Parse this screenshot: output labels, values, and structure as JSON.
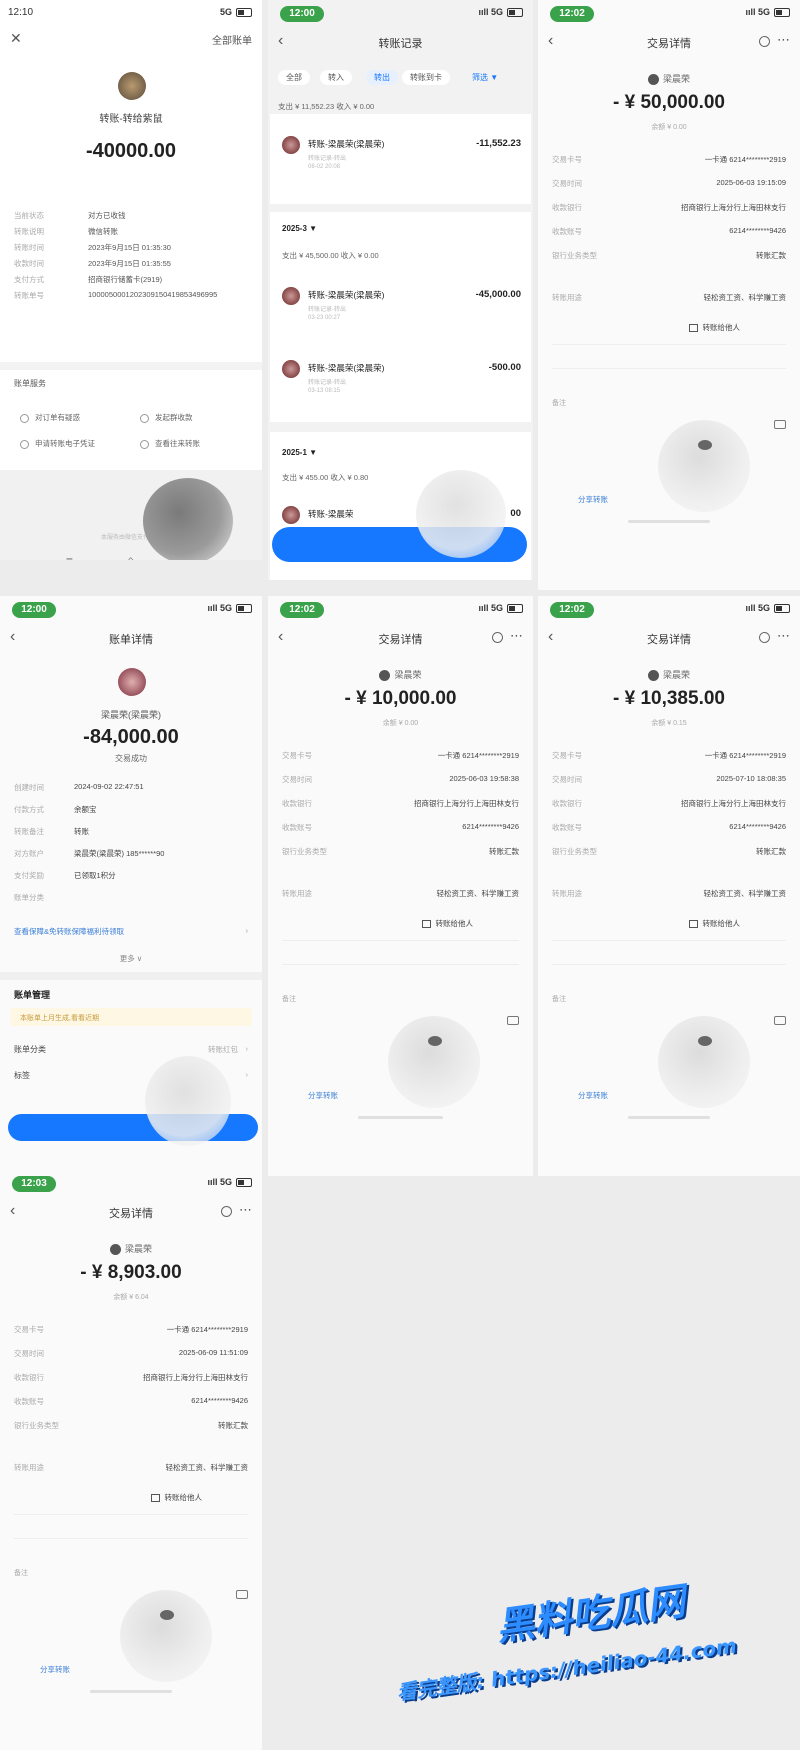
{
  "p1": {
    "status_time": "12:10",
    "close_label": "✕",
    "all_bills": "全部账单",
    "title": "转账-转给紫鼠",
    "amount": "-40000.00",
    "rows": [
      {
        "k": "当前状态",
        "v": "对方已收钱"
      },
      {
        "k": "转账说明",
        "v": "微信转账"
      },
      {
        "k": "转账时间",
        "v": "2023年9月15日 01:35:30"
      },
      {
        "k": "收款时间",
        "v": "2023年9月15日 01:35:55"
      },
      {
        "k": "支付方式",
        "v": "招商银行储蓄卡(2919)"
      },
      {
        "k": "转账单号",
        "v": "1000050001202309150419853496995"
      }
    ],
    "service_title": "账单服务",
    "services": [
      "对订单有疑惑",
      "发起群收款",
      "申请转账电子凭证",
      "查看往来转账"
    ],
    "bottom_hint": "本服务由微信支付提供"
  },
  "p2": {
    "status_time": "12:00",
    "signal": "5G",
    "title": "转账记录",
    "tabs": [
      "全部",
      "转入",
      "转出",
      "转账到卡",
      "筛选 ▼"
    ],
    "top_summary": "支出 ¥ 11,552.23    收入 ¥ 0.00",
    "items_top": [
      {
        "name": "转账-梁晨荣(梁晨荣)",
        "sub": "转账记录-转出",
        "time": "08-02 20:08",
        "amount": "-11,552.23"
      }
    ],
    "group2": {
      "month": "2025-3 ▼",
      "summary": "支出 ¥ 45,500.00    收入 ¥ 0.00",
      "items": [
        {
          "name": "转账-梁晨荣(梁晨荣)",
          "sub": "转账记录-转出",
          "time": "03-23 00:27",
          "amount": "-45,000.00"
        },
        {
          "name": "转账-梁晨荣(梁晨荣)",
          "sub": "转账记录-转出",
          "time": "03-13 08:15",
          "amount": "-500.00"
        }
      ]
    },
    "group3": {
      "month": "2025-1 ▼",
      "summary": "支出 ¥ 455.00    收入 ¥ 0.80",
      "items": [
        {
          "name": "转账-梁晨荣",
          "amount": "00"
        }
      ]
    }
  },
  "tx": {
    "nav_title": "交易详情",
    "payee": "梁晨荣",
    "labels": [
      "交易卡号",
      "交易时间",
      "收款银行",
      "收款账号",
      "银行业务类型",
      "转账用途",
      "备注"
    ],
    "remark_label": "备注",
    "tag_add": "转账给他人",
    "share_link": "分享转账"
  },
  "p3": {
    "status_time": "12:02",
    "signal": "5G",
    "amount": "- ¥ 50,000.00",
    "sub": "余额 ¥ 0.00",
    "vals": [
      "一卡通 6214********2919",
      "2025-06-03 19:15:09",
      "招商银行上海分行上海田林支行",
      "6214********9426",
      "转账汇款",
      "轻松资工资、科学赚工资"
    ]
  },
  "p4": {
    "status_time": "12:00",
    "signal": "5G",
    "nav_title": "账单详情",
    "name": "梁晨荣(梁晨荣)",
    "amount": "-84,000.00",
    "state": "交易成功",
    "rows": [
      {
        "k": "创建时间",
        "v": "2024-09-02 22:47:51"
      },
      {
        "k": "付款方式",
        "v": "余额宝"
      },
      {
        "k": "转账备注",
        "v": "转账"
      },
      {
        "k": "对方账户",
        "v": "梁晨荣(梁晨荣) 185******90"
      },
      {
        "k": "支付奖励",
        "v": "已领取1积分"
      },
      {
        "k": "账单分类",
        "v": ""
      }
    ],
    "promo": "查看保障&免转账保障福利待领取",
    "more": "更多 ∨",
    "mgmt_title": "账单管理",
    "notice": "本账单上月生成,看看近期",
    "mgmt_rows": [
      {
        "k": "账单分类",
        "v": "转账红包"
      },
      {
        "k": "标签",
        "v": ""
      }
    ]
  },
  "p5": {
    "status_time": "12:02",
    "signal": "5G",
    "amount": "- ¥ 10,000.00",
    "sub": "余额 ¥ 0.00",
    "vals": [
      "一卡通 6214********2919",
      "2025-06-03 19:58:38",
      "招商银行上海分行上海田林支行",
      "6214********9426",
      "转账汇款",
      "轻松资工资、科学赚工资"
    ]
  },
  "p6": {
    "status_time": "12:02",
    "signal": "5G",
    "amount": "- ¥ 10,385.00",
    "sub": "余额 ¥ 0.15",
    "vals": [
      "一卡通 6214********2919",
      "2025-07-10 18:08:35",
      "招商银行上海分行上海田林支行",
      "6214********9426",
      "转账汇款",
      "轻松资工资、科学赚工资"
    ]
  },
  "p7": {
    "status_time": "12:03",
    "signal": "5G",
    "amount": "- ¥ 8,903.00",
    "sub": "余额 ¥ 6.04",
    "vals": [
      "一卡通 6214********2919",
      "2025-06-09 11:51:09",
      "招商银行上海分行上海田林支行",
      "6214********9426",
      "转账汇款",
      "轻松资工资、科学赚工资"
    ]
  },
  "watermark": {
    "line1": "黑料吃瓜网",
    "line2": "看完整版: https://heiliao-44.com"
  },
  "colors": {
    "accent": "#1677ff",
    "status_pill": "#3aa24a",
    "link": "#3a7fd8",
    "watermark": "#2d8cff"
  }
}
